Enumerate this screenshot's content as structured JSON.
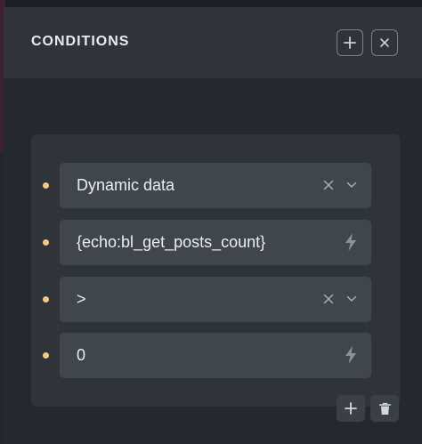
{
  "panel": {
    "title": "CONDITIONS",
    "header_buttons": [
      {
        "name": "add",
        "icon": "plus-icon"
      },
      {
        "name": "close",
        "icon": "close-icon"
      }
    ]
  },
  "condition": {
    "key": {
      "value": "Dynamic data",
      "icons": [
        "clear-icon",
        "chevron-down-icon"
      ]
    },
    "key_argument": {
      "value": "{echo:bl_get_posts_count}",
      "icon": "bolt-icon"
    },
    "compare": {
      "value": ">",
      "icons": [
        "clear-icon",
        "chevron-down-icon"
      ]
    },
    "value": {
      "value": "0",
      "icon": "bolt-icon"
    }
  },
  "actions": [
    {
      "name": "add-condition",
      "icon": "plus-icon"
    },
    {
      "name": "delete-condition",
      "icon": "trash-icon"
    }
  ],
  "colors": {
    "bullet": "#f3cf7a",
    "panel_header": "#30343a",
    "card": "#30343a",
    "field": "#41464d",
    "text": "#eceef1"
  }
}
